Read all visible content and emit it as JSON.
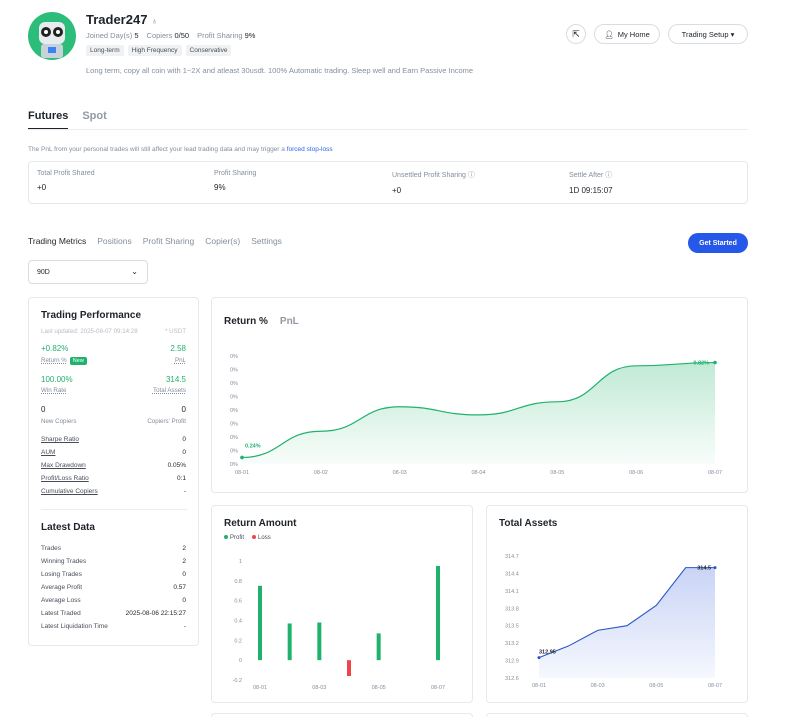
{
  "profile": {
    "name": "Trader247",
    "joined_label": "Joined Day(s)",
    "joined_value": "5",
    "copiers_label": "Copiers",
    "copiers_value": "0/50",
    "profit_share_label": "Profit Sharing",
    "profit_share_value": "9%",
    "tags": [
      "Long-term",
      "High Frequency",
      "Conservative"
    ],
    "bio": "Long term, copy all coin with 1~2X and atleast 30usdt. 100% Automatic trading. Sleep well and Earn Passive Income"
  },
  "header_buttons": {
    "share_icon": "share-icon",
    "my_home": "My Home",
    "trading_setup": "Trading Setup ▾"
  },
  "nav": {
    "futures": "Futures",
    "spot": "Spot"
  },
  "notice": {
    "text": "The PnL from your personal trades will still affect your lead trading data and may trigger a ",
    "link": "forced stop-loss"
  },
  "summary": [
    {
      "label": "Total Profit Shared",
      "value": "+0"
    },
    {
      "label": "Profit Sharing",
      "value": "9%"
    },
    {
      "label": "Unsettled Profit Sharing ⓘ",
      "value": "+0"
    },
    {
      "label": "Settle After ⓘ",
      "value": "1D 09:15:07"
    }
  ],
  "metric_tabs": [
    "Trading Metrics",
    "Positions",
    "Profit Sharing",
    "Copier(s)",
    "Settings"
  ],
  "get_started": "Get Started",
  "period": {
    "value": "90D",
    "chevron": "chevron-down-icon"
  },
  "performance": {
    "title": "Trading Performance",
    "updated": "Last updated: 2025-08-07 09:14:28",
    "currency": "* USDT",
    "return_value": "+0.82%",
    "return_label": "Return %",
    "new_badge": "New",
    "pnl_value": "2.58",
    "pnl_label": "PnL",
    "winrate_value": "100.00%",
    "winrate_label": "Win Rate",
    "assets_value": "314.5",
    "assets_label": "Total Assets",
    "new_copiers_value": "0",
    "new_copiers_label": "New Copiers",
    "copiers_profit_value": "0",
    "copiers_profit_label": "Copiers' Profit",
    "rows": [
      {
        "label": "Sharpe Ratio",
        "value": "0"
      },
      {
        "label": "AUM",
        "value": "0"
      },
      {
        "label": "Max Drawdown",
        "value": "0.05%"
      },
      {
        "label": "Profit/Loss Ratio",
        "value": "0:1"
      },
      {
        "label": "Cumulative Copiers",
        "value": "-"
      }
    ]
  },
  "latest": {
    "title": "Latest Data",
    "rows": [
      {
        "label": "Trades",
        "value": "2"
      },
      {
        "label": "Winning Trades",
        "value": "2"
      },
      {
        "label": "Losing Trades",
        "value": "0"
      },
      {
        "label": "Average Profit",
        "value": "0.57"
      },
      {
        "label": "Average Loss",
        "value": "0"
      },
      {
        "label": "Latest Traded",
        "value": "2025-08-06 22:15:27"
      },
      {
        "label": "Latest Liquidation Time",
        "value": "-"
      }
    ]
  },
  "return_card": {
    "tab_active": "Return %",
    "tab_inactive": "PnL"
  },
  "amount_card": {
    "title": "Return Amount",
    "legend_profit": "Profit",
    "legend_loss": "Loss"
  },
  "assets_card": {
    "title": "Total Assets"
  },
  "colors": {
    "accent": "#2557e8",
    "profit": "#20b26c",
    "loss": "#ef454a",
    "assets_line": "#2b55c9"
  },
  "chart_data": [
    {
      "type": "area",
      "title": "Return %",
      "x": [
        "08-01",
        "08-02",
        "08-03",
        "08-04",
        "08-05",
        "08-06",
        "08-07"
      ],
      "values": [
        0.24,
        0.4,
        0.55,
        0.5,
        0.58,
        0.8,
        0.82
      ],
      "y_ticks": [
        "0%",
        "0%",
        "0%",
        "0%",
        "0%",
        "0%",
        "0%",
        "0%",
        "0%"
      ],
      "start_label": "0.24%",
      "end_label": "0.82%",
      "ylim": [
        0.2,
        0.86
      ]
    },
    {
      "type": "bar",
      "title": "Return Amount",
      "x": [
        "08-01",
        "08-02",
        "08-03",
        "08-04",
        "08-05",
        "08-06",
        "08-07"
      ],
      "x_ticks": [
        "08-01",
        "08-03",
        "08-05",
        "08-07"
      ],
      "series": [
        {
          "name": "Profit",
          "values": [
            0.75,
            0.37,
            0.38,
            0,
            0.27,
            0,
            0.95
          ]
        },
        {
          "name": "Loss",
          "values": [
            0,
            0,
            0,
            -0.16,
            0,
            0,
            0
          ]
        }
      ],
      "y_ticks": [
        "1",
        "0.8",
        "0.6",
        "0.4",
        "0.2",
        "0",
        "-0.2"
      ],
      "ylim": [
        -0.2,
        1.0
      ]
    },
    {
      "type": "area",
      "title": "Total Assets",
      "x": [
        "08-01",
        "08-02",
        "08-03",
        "08-04",
        "08-05",
        "08-06",
        "08-07"
      ],
      "x_ticks": [
        "08-01",
        "08-03",
        "08-05",
        "08-07"
      ],
      "values": [
        312.95,
        313.15,
        313.42,
        313.5,
        313.85,
        314.5,
        314.5
      ],
      "y_ticks": [
        "314.7",
        "314.4",
        "314.1",
        "313.8",
        "313.5",
        "313.2",
        "312.9",
        "312.6"
      ],
      "start_label": "312.95",
      "end_label": "314.5",
      "ylim": [
        312.6,
        314.7
      ]
    }
  ]
}
